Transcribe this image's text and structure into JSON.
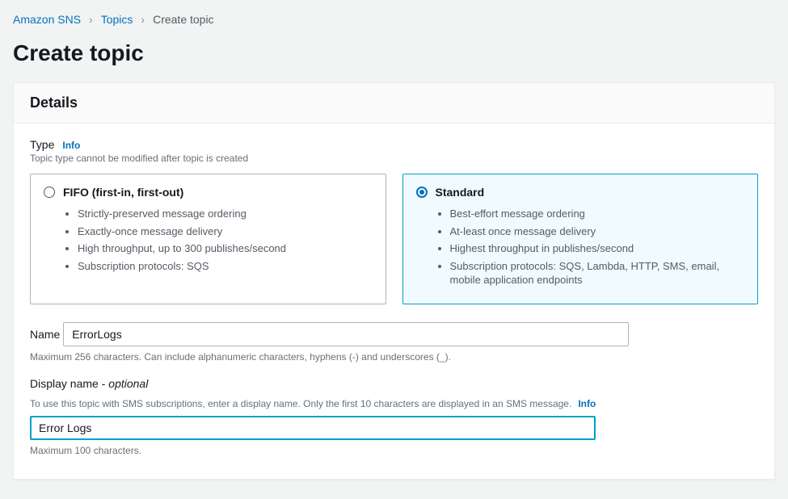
{
  "breadcrumb": {
    "root": "Amazon SNS",
    "topics": "Topics",
    "current": "Create topic"
  },
  "page_title": "Create topic",
  "panel": {
    "heading": "Details",
    "type_section": {
      "label": "Type",
      "info": "Info",
      "hint": "Topic type cannot be modified after topic is created",
      "fifo": {
        "title": "FIFO (first-in, first-out)",
        "bullets": [
          "Strictly-preserved message ordering",
          "Exactly-once message delivery",
          "High throughput, up to 300 publishes/second",
          "Subscription protocols: SQS"
        ]
      },
      "standard": {
        "title": "Standard",
        "bullets": [
          "Best-effort message ordering",
          "At-least once message delivery",
          "Highest throughput in publishes/second",
          "Subscription protocols: SQS, Lambda, HTTP, SMS, email, mobile application endpoints"
        ]
      }
    },
    "name_section": {
      "label": "Name",
      "value": "ErrorLogs",
      "hint": "Maximum 256 characters. Can include alphanumeric characters, hyphens (-) and underscores (_)."
    },
    "display_section": {
      "label_main": "Display name",
      "label_sep": " - ",
      "label_opt": "optional",
      "hint": "To use this topic with SMS subscriptions, enter a display name. Only the first 10 characters are displayed in an SMS message.",
      "info": "Info",
      "value": "Error Logs",
      "below": "Maximum 100 characters."
    }
  }
}
